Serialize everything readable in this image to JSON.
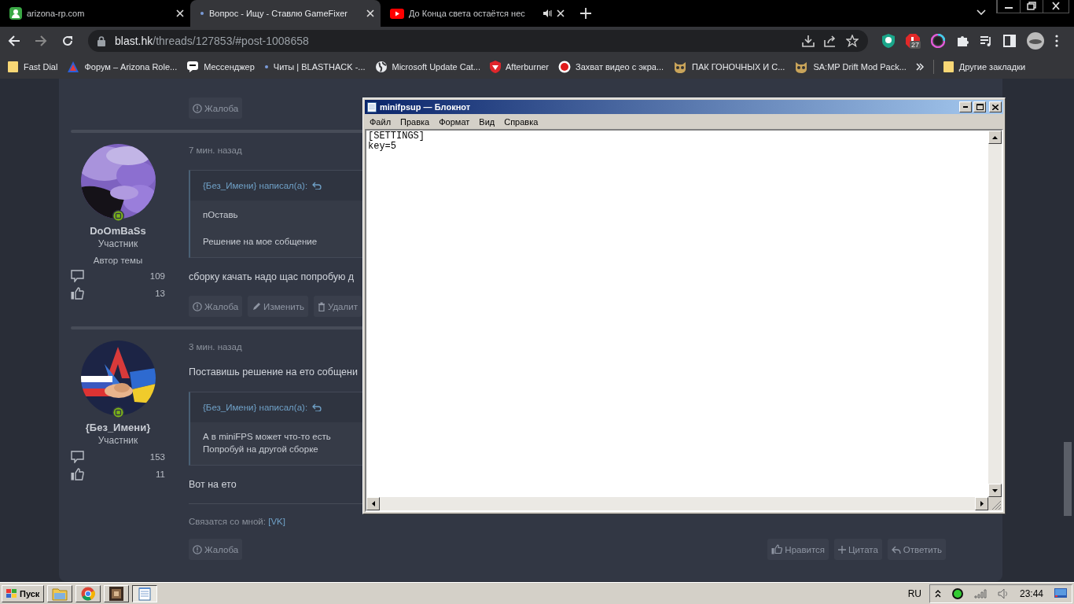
{
  "browser": {
    "tabs": [
      {
        "kind": "user",
        "title": "arizona-rp.com",
        "selected": false
      },
      {
        "kind": "dot",
        "title": "Вопрос - Ищу - Ставлю GameFixer",
        "selected": true
      },
      {
        "kind": "video",
        "title": "До Конца света остаётся нес",
        "selected": false
      }
    ],
    "address": {
      "host": "blast.hk",
      "path": "/threads/127853/#post-1008658"
    },
    "extension_badge": "27",
    "bookmarks": [
      {
        "kind": "folder",
        "title": "Fast Dial"
      },
      {
        "kind": "triangle",
        "title": "Форум – Arizona Role..."
      },
      {
        "kind": "chat",
        "title": "Мессенджер"
      },
      {
        "kind": "dot",
        "title": "Читы | BLASTHACK -..."
      },
      {
        "kind": "globe",
        "title": "Microsoft Update Cat..."
      },
      {
        "kind": "shield",
        "title": "Afterburner"
      },
      {
        "kind": "record",
        "title": "Захват видео с экра..."
      },
      {
        "kind": "game",
        "title": "ПАК ГОНОЧНЫХ И С..."
      },
      {
        "kind": "game",
        "title": "SA:MP Drift Mod Pack..."
      }
    ],
    "other_bookmarks": "Другие закладки"
  },
  "forum": {
    "posts": [
      {
        "kind": "fragment",
        "actions": [
          {
            "kind": "report",
            "label": "Жалоба"
          }
        ]
      },
      {
        "kind": "full",
        "author": {
          "name": "DoOmBaSs",
          "role": "Участник",
          "badge": "Автор темы",
          "messages": "109",
          "likes": "13"
        },
        "time": "7 мин. назад",
        "blocks": [
          {
            "kind": "quote",
            "author": "{Без_Имени} написал(а):",
            "paragraphs": [
              "пОставь",
              "Решение на мое собщение"
            ]
          },
          {
            "kind": "text",
            "text": "сборку качать надо щас попробую д"
          }
        ],
        "actions": [
          {
            "kind": "report",
            "label": "Жалоба"
          },
          {
            "kind": "edit",
            "label": "Изменить"
          },
          {
            "kind": "delete",
            "label": "Удалит"
          }
        ]
      },
      {
        "kind": "full",
        "author": {
          "name": "{Без_Имени}",
          "role": "Участник",
          "messages": "153",
          "likes": "11"
        },
        "time": "3 мин. назад",
        "blocks": [
          {
            "kind": "text",
            "text": "Поставишь решение на ето собщени"
          },
          {
            "kind": "quote",
            "author": "{Без_Имени} написал(а):",
            "paragraphs": [
              "А в miniFPS может что-то есть\nПопробуй на другой сборке"
            ]
          },
          {
            "kind": "text",
            "text": "Вот на ето"
          },
          {
            "kind": "signature",
            "text": "Связатся со мной:",
            "link": "[VK]"
          }
        ],
        "actions": [
          {
            "kind": "report",
            "label": "Жалоба"
          }
        ],
        "right_actions": [
          {
            "kind": "like",
            "label": "Нравится"
          },
          {
            "kind": "quote",
            "label": "Цитата"
          },
          {
            "kind": "reply",
            "label": "Ответить"
          }
        ]
      }
    ]
  },
  "notepad": {
    "title": "minifpsup — Блокнот",
    "menu": [
      "Файл",
      "Правка",
      "Формат",
      "Вид",
      "Справка"
    ],
    "content": "[SETTINGS]\nkey=5"
  },
  "taskbar": {
    "start": "Пуск",
    "apps": [
      {
        "kind": "folder",
        "selected": false
      },
      {
        "kind": "browser",
        "selected": false
      },
      {
        "kind": "game",
        "selected": false
      },
      {
        "kind": "notepad",
        "selected": true
      }
    ],
    "language": "RU",
    "clock": "23:44"
  }
}
